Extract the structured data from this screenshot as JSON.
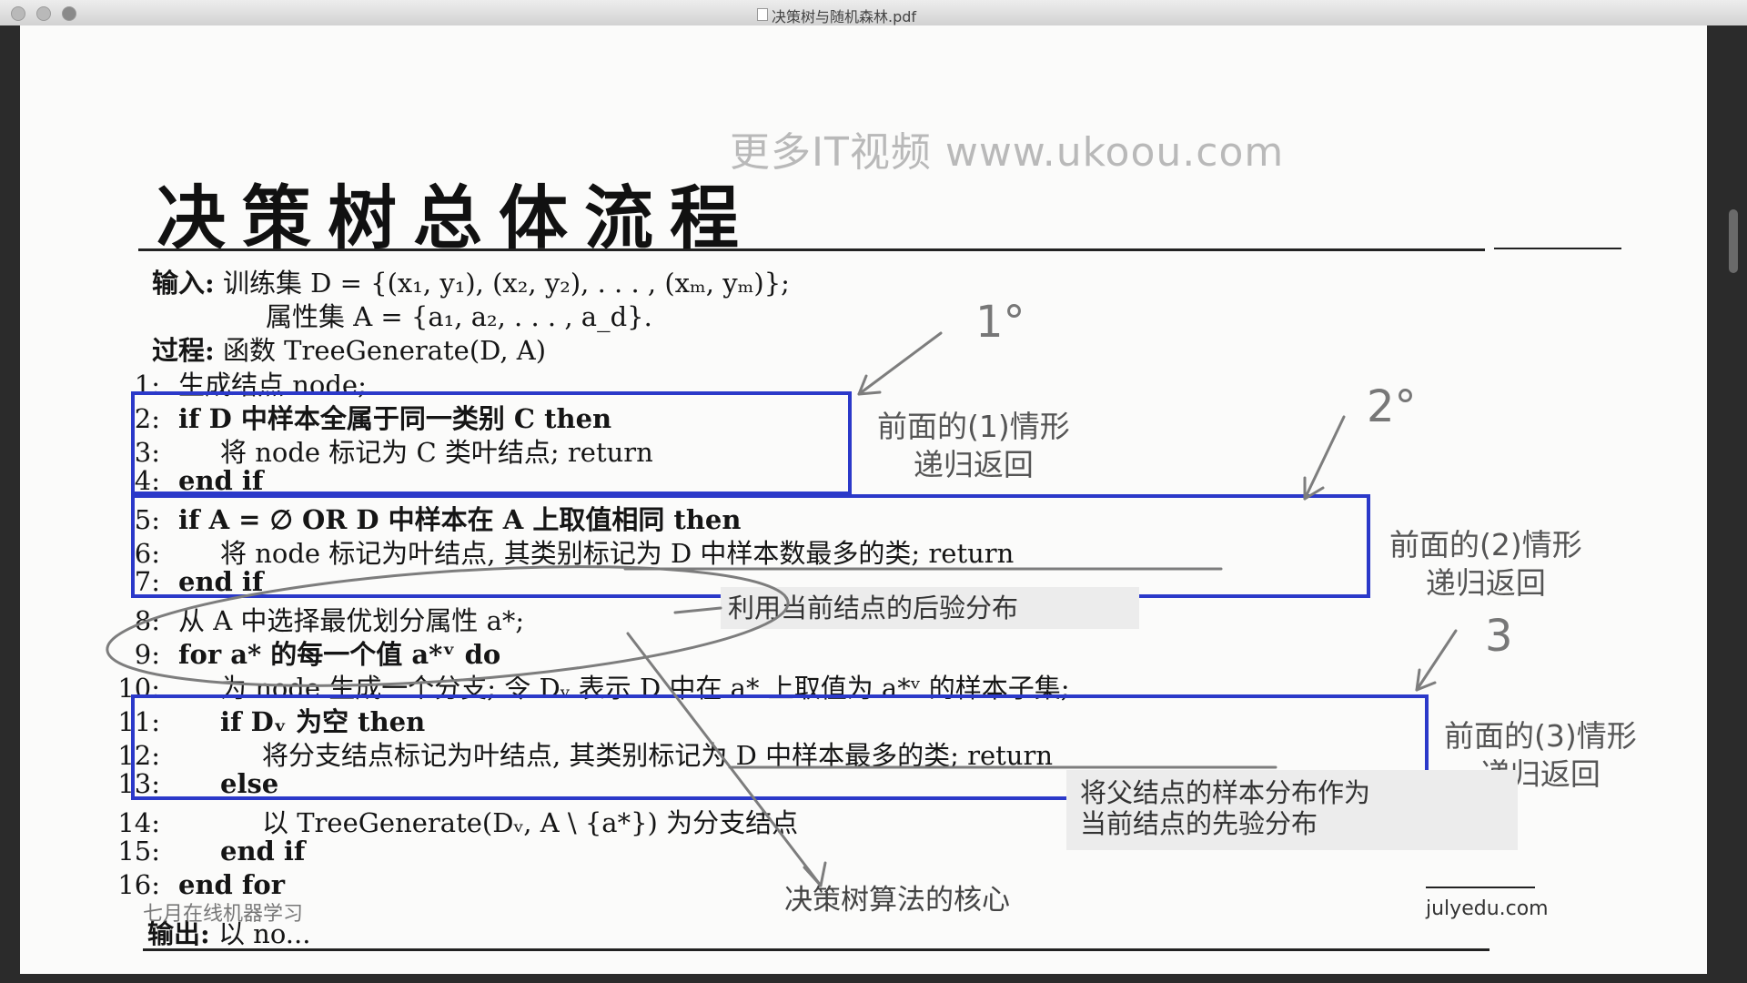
{
  "window": {
    "title": "决策树与随机森林.pdf"
  },
  "watermark": "更多IT视频 www.ukoou.com",
  "slide": {
    "title": "决策树总体流程",
    "input_label": "输入:",
    "input_line1": "训练集 D = {(x₁, y₁), (x₂, y₂), . . . , (xₘ, yₘ)};",
    "input_line2": "属性集 A = {a₁, a₂, . . . , a_d}.",
    "process_label": "过程:",
    "process_text": "函数 TreeGenerate(D, A)",
    "lines": [
      {
        "n": "1:",
        "text": "生成结点 node;"
      },
      {
        "n": "2:",
        "text": "if D 中样本全属于同一类别 C  then"
      },
      {
        "n": "3:",
        "text": "将 node 标记为 C 类叶结点; return"
      },
      {
        "n": "4:",
        "text": "end if"
      },
      {
        "n": "5:",
        "text": "if A = ∅  OR D 中样本在 A 上取值相同 then"
      },
      {
        "n": "6:",
        "text": "将 node 标记为叶结点, 其类别标记为 D 中样本数最多的类; return"
      },
      {
        "n": "7:",
        "text": "end if"
      },
      {
        "n": "8:",
        "text": "从 A 中选择最优划分属性 a*;"
      },
      {
        "n": "9:",
        "text": "for a* 的每一个值 a*ᵛ do"
      },
      {
        "n": "10:",
        "text": "为 node 生成一个分支; 令 Dᵥ 表示 D 中在 a* 上取值为 a*ᵛ 的样本子集;"
      },
      {
        "n": "11:",
        "text": "if Dᵥ 为空 then"
      },
      {
        "n": "12:",
        "text": "将分支结点标记为叶结点, 其类别标记为 D 中样本最多的类; return"
      },
      {
        "n": "13:",
        "text": "else"
      },
      {
        "n": "14:",
        "text": "以 TreeGenerate(Dᵥ, A \\ {a*}) 为分支结点"
      },
      {
        "n": "15:",
        "text": "end if"
      },
      {
        "n": "16:",
        "text": "end for"
      }
    ],
    "output_label": "输出:",
    "output_text": "以 no..."
  },
  "annotations": {
    "case1": [
      "前面的(1)情形",
      "递归返回"
    ],
    "case2": [
      "前面的(2)情形",
      "递归返回"
    ],
    "case3": [
      "前面的(3)情形",
      "递归返回"
    ],
    "posterior": "利用当前结点的后验分布",
    "prior": [
      "将父结点的样本分布作为",
      "当前结点的先验分布"
    ],
    "core": "决策树算法的核心",
    "mark1": "1°",
    "mark2": "2°",
    "mark3": "3"
  },
  "footer": {
    "left": "七月在线机器学习",
    "right": "julyedu.com"
  },
  "colors": {
    "box_blue": "#2b39c9",
    "ink": "#7a7a7a"
  }
}
